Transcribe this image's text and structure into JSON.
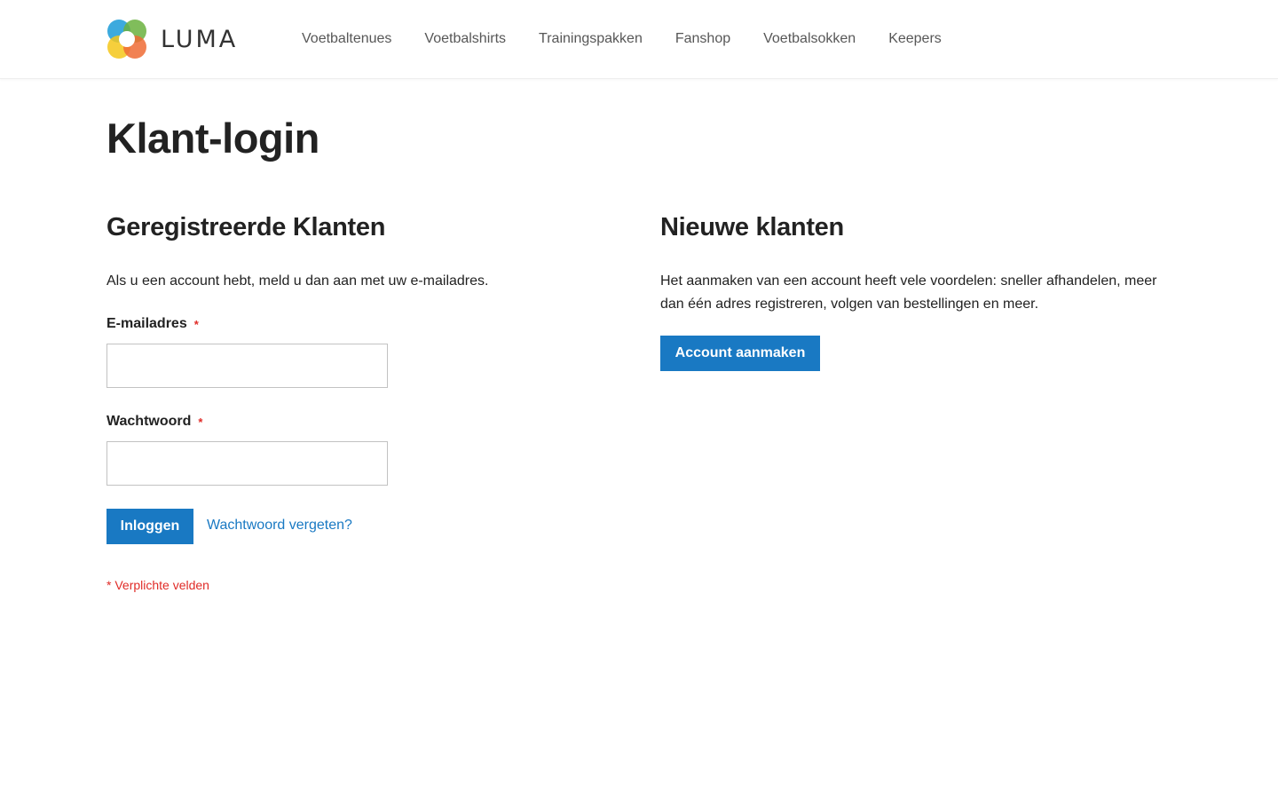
{
  "header": {
    "logo_text": "LUMA",
    "nav": [
      {
        "label": "Voetbaltenues"
      },
      {
        "label": "Voetbalshirts"
      },
      {
        "label": "Trainingspakken"
      },
      {
        "label": "Fanshop"
      },
      {
        "label": "Voetbalsokken"
      },
      {
        "label": "Keepers"
      }
    ]
  },
  "page": {
    "title": "Klant-login"
  },
  "registered": {
    "title": "Geregistreerde Klanten",
    "intro": "Als u een account hebt, meld u dan aan met uw e-mailadres.",
    "email_label": "E-mailadres",
    "email_value": "",
    "password_label": "Wachtwoord",
    "password_value": "",
    "required_marker": "*",
    "login_button": "Inloggen",
    "forgot_link": "Wachtwoord vergeten?",
    "required_note": "* Verplichte velden"
  },
  "new_customers": {
    "title": "Nieuwe klanten",
    "intro": "Het aanmaken van een account heeft vele voordelen: sneller afhandelen, meer dan één adres registreren, volgen van bestellingen en meer.",
    "create_button": "Account aanmaken"
  },
  "colors": {
    "primary": "#1979c3",
    "required": "#e02b27",
    "text": "#222222",
    "nav_text": "#575757"
  },
  "icons": {
    "logo": "luma-logo-icon"
  }
}
